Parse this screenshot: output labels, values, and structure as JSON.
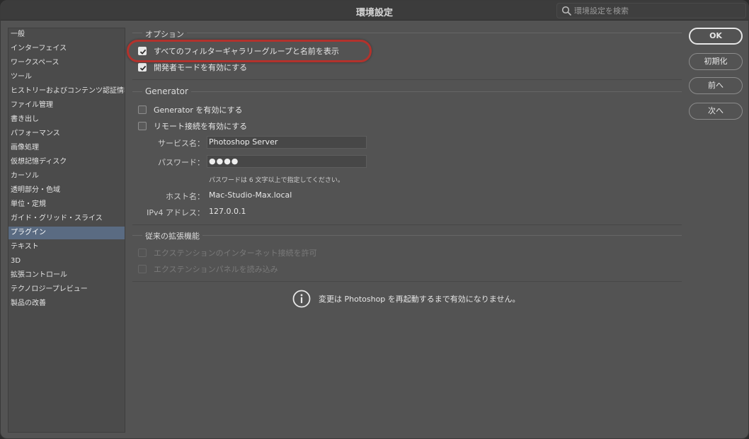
{
  "window": {
    "title": "環境設定"
  },
  "search": {
    "placeholder": "環境設定を検索",
    "icon": "search-icon"
  },
  "sidebar": {
    "items": [
      {
        "label": "一般"
      },
      {
        "label": "インターフェイス"
      },
      {
        "label": "ワークスペース"
      },
      {
        "label": "ツール"
      },
      {
        "label": "ヒストリーおよびコンテンツ認証情報"
      },
      {
        "label": "ファイル管理"
      },
      {
        "label": "書き出し"
      },
      {
        "label": "パフォーマンス"
      },
      {
        "label": "画像処理"
      },
      {
        "label": "仮想記憶ディスク"
      },
      {
        "label": "カーソル"
      },
      {
        "label": "透明部分・色域"
      },
      {
        "label": "単位・定規"
      },
      {
        "label": "ガイド・グリッド・スライス"
      },
      {
        "label": "プラグイン",
        "selected": true
      },
      {
        "label": "テキスト"
      },
      {
        "label": "3D"
      },
      {
        "label": "拡張コントロール"
      },
      {
        "label": "テクノロジープレビュー"
      },
      {
        "label": "製品の改善"
      }
    ]
  },
  "options": {
    "title": "オプション",
    "show_all_filter_gallery": {
      "label": "すべてのフィルターギャラリーグループと名前を表示",
      "checked": true
    },
    "developer_mode": {
      "label": "開発者モードを有効にする",
      "checked": true
    }
  },
  "generator": {
    "title": "Generator",
    "enable_generator": {
      "label": "Generator を有効にする",
      "checked": false
    },
    "enable_remote": {
      "label": "リモート接続を有効にする",
      "checked": false
    },
    "service_name_label": "サービス名：",
    "service_name_value": "Photoshop Server",
    "password_label": "パスワード：",
    "password_value": "●●●●",
    "password_hint": "パスワードは 6 文字以上で指定してください。",
    "host_label": "ホスト名：",
    "host_value": "Mac-Studio-Max.local",
    "ipv4_label": "IPv4 アドレス：",
    "ipv4_value": "127.0.0.1"
  },
  "legacy": {
    "title": "従来の拡張機能",
    "allow_internet": {
      "label": "エクステンションのインターネット接続を許可",
      "checked": false,
      "disabled": true
    },
    "load_panels": {
      "label": "エクステンションパネルを読み込み",
      "checked": false,
      "disabled": true
    }
  },
  "notice": {
    "text": "変更は Photoshop を再起動するまで有効になりません。",
    "icon": "info-icon"
  },
  "buttons": {
    "ok": "OK",
    "reset": "初期化",
    "prev": "前へ",
    "next": "次へ"
  },
  "colors": {
    "highlight": "#b3322c",
    "selected": "#5a6b82",
    "panel": "#535353"
  }
}
